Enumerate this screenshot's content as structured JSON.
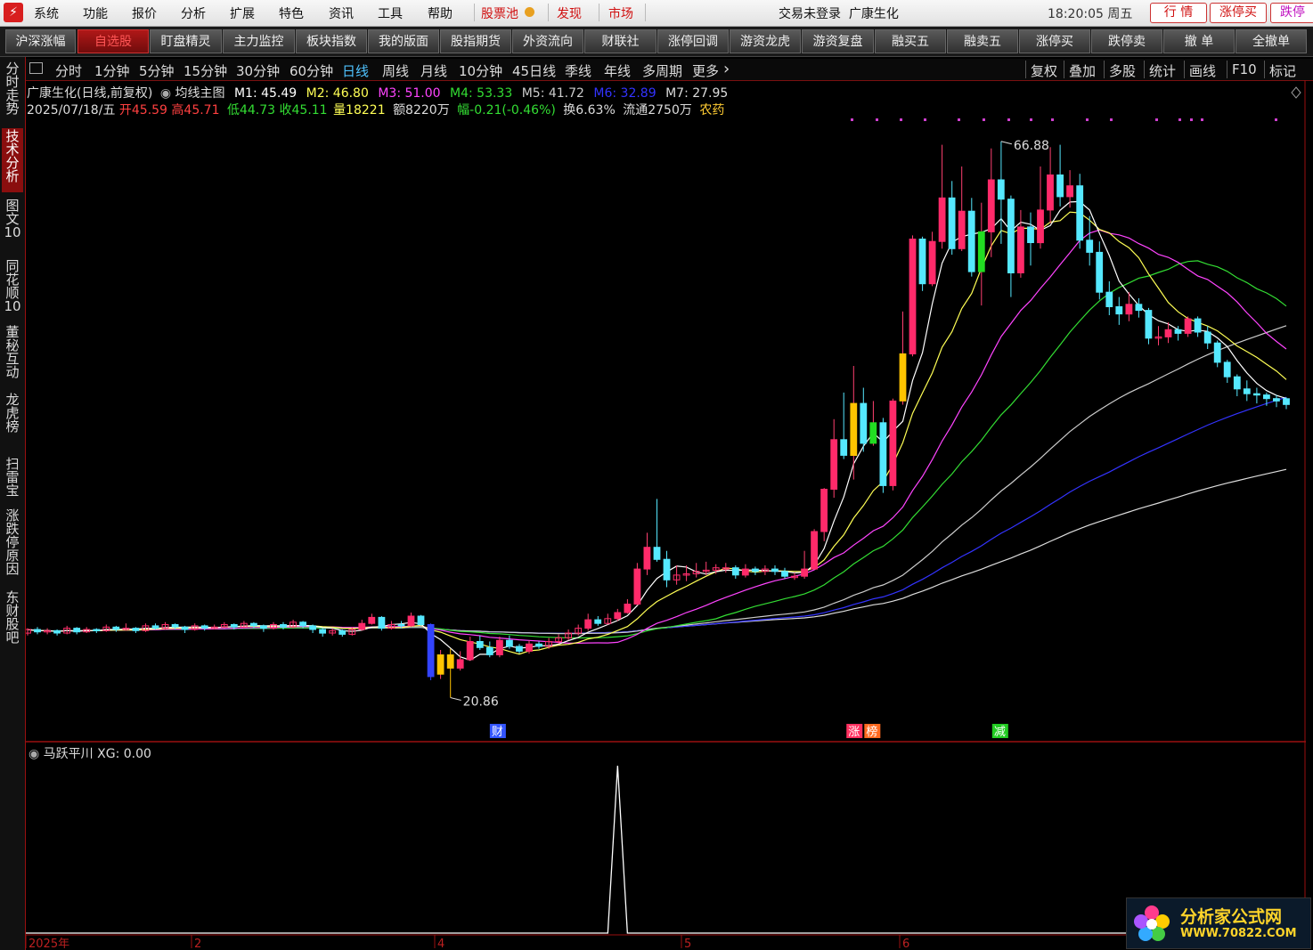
{
  "menubar": {
    "items": [
      "系统",
      "功能",
      "报价",
      "分析",
      "扩展",
      "特色",
      "资讯",
      "工具",
      "帮助"
    ],
    "highlight_items": [
      "股票池",
      "发现",
      "市场"
    ],
    "title": "交易未登录",
    "stock_name": "广康生化",
    "clock": "18:20:05 周五",
    "right_buttons": [
      "行 情",
      "涨停买",
      "跌停"
    ]
  },
  "toolbar": {
    "buttons": [
      "沪深涨幅",
      "自选股",
      "盯盘精灵",
      "主力监控",
      "板块指数",
      "我的版面",
      "股指期货",
      "外资流向",
      "财联社",
      "涨停回调",
      "游资龙虎",
      "游资复盘",
      "融买五",
      "融卖五",
      "涨停买",
      "跌停卖",
      "撤 单",
      "全撤单"
    ]
  },
  "sidebar": {
    "items": [
      "分时走势",
      "技术分析",
      "图文10",
      "同花顺10",
      "董秘互动",
      "龙虎榜",
      "扫雷宝",
      "涨跌停原因",
      "东财股吧"
    ],
    "active": "技术分析"
  },
  "periods": {
    "items": [
      "分时",
      "1分钟",
      "5分钟",
      "15分钟",
      "30分钟",
      "60分钟",
      "日线",
      "周线",
      "月线",
      "10分钟",
      "45日线",
      "季线",
      "年线",
      "多周期",
      "更多"
    ],
    "active": "日线",
    "right_tools": [
      "复权",
      "叠加",
      "多股",
      "统计",
      "画线",
      "F10",
      "标记"
    ]
  },
  "info": {
    "title": "广康生化(日线,前复权)",
    "indicator": "均线主图",
    "m1": "M1: 45.49",
    "m2": "M2: 46.80",
    "m3": "M3: 51.00",
    "m4": "M4: 53.33",
    "m5": "M5: 41.72",
    "m6": "M6: 32.89",
    "m7": "M7: 27.95",
    "date": "2025/07/18/五",
    "open": "开45.59",
    "high": "高45.71",
    "low": "低44.73",
    "close": "收45.11",
    "volume": "量18221",
    "amount": "额8220万",
    "change": "幅-0.21(-0.46%)",
    "turnover": "换6.63%",
    "float": "流通2750万",
    "sector": "农药"
  },
  "chart_data": {
    "type": "candlestick",
    "high_marker": "66.88",
    "low_marker": "20.86",
    "event_labels": [
      "财",
      "涨",
      "榜",
      "减"
    ],
    "ma_colors": {
      "M1": "#ffffff",
      "M2": "#ffff55",
      "M3": "#ff44ff",
      "M4": "#33dd33",
      "M5": "#cccccc",
      "M6": "#3333ff",
      "M7": "#dddddd"
    },
    "candles": [
      [
        26.2,
        26.5,
        26.6,
        26.0
      ],
      [
        26.5,
        26.3,
        26.7,
        26.1
      ],
      [
        26.3,
        26.4,
        26.6,
        26.1
      ],
      [
        26.4,
        26.2,
        26.5,
        26.0
      ],
      [
        26.2,
        26.6,
        26.8,
        26.1
      ],
      [
        26.6,
        26.3,
        26.7,
        26.1
      ],
      [
        26.3,
        26.5,
        26.7,
        26.2
      ],
      [
        26.5,
        26.4,
        26.6,
        26.2
      ],
      [
        26.4,
        26.7,
        26.9,
        26.3
      ],
      [
        26.7,
        26.5,
        26.8,
        26.3
      ],
      [
        26.5,
        26.6,
        27.0,
        26.4
      ],
      [
        26.6,
        26.4,
        26.7,
        26.2
      ],
      [
        26.4,
        26.8,
        27.0,
        26.3
      ],
      [
        26.8,
        26.6,
        27.0,
        26.5
      ],
      [
        26.6,
        26.9,
        27.1,
        26.5
      ],
      [
        26.9,
        26.7,
        27.0,
        26.5
      ],
      [
        26.7,
        26.5,
        26.8,
        26.2
      ],
      [
        26.5,
        26.8,
        27.0,
        26.4
      ],
      [
        26.8,
        26.6,
        26.9,
        26.4
      ],
      [
        26.6,
        26.7,
        26.9,
        26.5
      ],
      [
        26.7,
        26.9,
        27.1,
        26.6
      ],
      [
        26.9,
        26.7,
        27.0,
        26.5
      ],
      [
        26.7,
        27.0,
        27.2,
        26.6
      ],
      [
        27.0,
        26.8,
        27.1,
        26.6
      ],
      [
        26.8,
        26.6,
        26.9,
        26.3
      ],
      [
        26.6,
        26.9,
        27.1,
        26.5
      ],
      [
        26.9,
        26.7,
        27.1,
        26.5
      ],
      [
        26.7,
        27.1,
        27.3,
        26.6
      ],
      [
        27.1,
        26.8,
        27.2,
        26.6
      ],
      [
        26.8,
        26.5,
        26.9,
        26.2
      ],
      [
        26.5,
        26.2,
        26.6,
        25.9
      ],
      [
        26.2,
        26.4,
        26.6,
        26.0
      ],
      [
        26.4,
        26.1,
        26.5,
        25.9
      ],
      [
        26.1,
        26.5,
        26.7,
        26.0
      ],
      [
        26.5,
        27.0,
        27.3,
        26.4
      ],
      [
        27.0,
        27.5,
        27.8,
        26.9
      ],
      [
        27.5,
        26.6,
        27.6,
        26.4
      ],
      [
        26.6,
        26.9,
        27.2,
        26.5
      ],
      [
        26.9,
        26.8,
        27.2,
        26.6
      ],
      [
        26.8,
        27.6,
        27.9,
        26.7
      ],
      [
        27.6,
        26.9,
        27.7,
        26.8
      ],
      [
        26.9,
        22.6,
        27.0,
        22.3
      ],
      [
        22.8,
        24.4,
        24.8,
        22.4
      ],
      [
        24.4,
        23.3,
        24.9,
        20.86
      ],
      [
        23.3,
        24.0,
        24.7,
        23.1
      ],
      [
        24.0,
        25.5,
        25.9,
        23.9
      ],
      [
        25.5,
        25.0,
        26.0,
        24.8
      ],
      [
        25.0,
        24.4,
        25.5,
        24.2
      ],
      [
        24.4,
        25.6,
        25.9,
        24.2
      ],
      [
        25.6,
        25.1,
        26.0,
        24.9
      ],
      [
        25.1,
        24.7,
        25.3,
        24.5
      ],
      [
        24.7,
        25.3,
        25.6,
        24.5
      ],
      [
        25.3,
        25.1,
        25.5,
        24.9
      ],
      [
        25.1,
        25.5,
        25.8,
        24.9
      ],
      [
        25.5,
        25.8,
        26.1,
        25.3
      ],
      [
        25.8,
        26.2,
        26.5,
        25.6
      ],
      [
        26.2,
        26.6,
        26.9,
        26.0
      ],
      [
        26.6,
        27.3,
        27.8,
        26.4
      ],
      [
        27.3,
        27.0,
        27.6,
        26.8
      ],
      [
        27.0,
        27.4,
        27.8,
        26.9
      ],
      [
        27.4,
        27.9,
        28.2,
        27.2
      ],
      [
        27.9,
        28.6,
        29.0,
        27.8
      ],
      [
        28.6,
        31.5,
        32.0,
        28.5
      ],
      [
        31.5,
        33.3,
        34.5,
        31.0
      ],
      [
        33.3,
        32.3,
        37.3,
        32.1
      ],
      [
        32.3,
        30.6,
        33.0,
        30.0
      ],
      [
        30.6,
        31.0,
        31.8,
        30.2
      ],
      [
        31.0,
        31.1,
        31.8,
        30.5
      ],
      [
        31.1,
        31.3,
        32.0,
        30.8
      ],
      [
        31.3,
        31.4,
        32.1,
        31.0
      ],
      [
        31.4,
        31.6,
        31.9,
        31.1
      ],
      [
        31.6,
        31.6,
        32.0,
        31.2
      ],
      [
        31.6,
        31.0,
        31.8,
        30.7
      ],
      [
        31.0,
        31.5,
        31.9,
        30.8
      ],
      [
        31.5,
        31.3,
        31.7,
        31.0
      ],
      [
        31.3,
        31.5,
        31.8,
        31.0
      ],
      [
        31.5,
        31.3,
        31.8,
        31.0
      ],
      [
        31.3,
        30.9,
        31.6,
        30.7
      ],
      [
        30.9,
        30.9,
        31.2,
        30.6
      ],
      [
        30.9,
        31.5,
        33.0,
        30.7
      ],
      [
        31.5,
        34.6,
        34.8,
        31.5
      ],
      [
        34.6,
        38.1,
        38.2,
        33.8
      ],
      [
        38.1,
        42.2,
        43.9,
        37.4
      ],
      [
        42.2,
        40.9,
        46.1,
        40.6
      ],
      [
        40.9,
        45.2,
        48.3,
        38.9
      ],
      [
        45.2,
        41.9,
        46.5,
        41.2
      ],
      [
        41.9,
        43.6,
        45.4,
        41.7
      ],
      [
        43.6,
        38.4,
        44.0,
        37.8
      ],
      [
        38.4,
        45.4,
        45.6,
        38.0
      ],
      [
        45.4,
        49.3,
        52.8,
        45.1
      ],
      [
        49.3,
        58.8,
        59.1,
        49.1
      ],
      [
        58.8,
        55.1,
        59.0,
        54.5
      ],
      [
        55.1,
        58.6,
        59.4,
        54.9
      ],
      [
        58.6,
        62.2,
        66.6,
        58.0
      ],
      [
        62.2,
        58.0,
        63.6,
        57.5
      ],
      [
        58.0,
        61.1,
        64.8,
        57.8
      ],
      [
        61.1,
        56.1,
        62.2,
        55.7
      ],
      [
        56.1,
        59.4,
        61.8,
        53.3
      ],
      [
        59.4,
        63.7,
        66.3,
        57.3
      ],
      [
        63.7,
        62.1,
        66.88,
        58.4
      ],
      [
        62.1,
        56.0,
        62.4,
        54.0
      ],
      [
        56.0,
        59.8,
        61.2,
        55.6
      ],
      [
        59.8,
        58.5,
        61.0,
        56.6
      ],
      [
        58.5,
        61.2,
        64.8,
        58.0
      ],
      [
        61.2,
        64.1,
        66.4,
        60.1
      ],
      [
        64.1,
        62.3,
        66.6,
        61.5
      ],
      [
        62.3,
        63.2,
        64.5,
        61.4
      ],
      [
        63.2,
        58.7,
        64.2,
        58.0
      ],
      [
        58.7,
        57.7,
        60.7,
        56.6
      ],
      [
        57.7,
        54.4,
        58.6,
        53.8
      ],
      [
        54.4,
        53.2,
        55.3,
        52.5
      ],
      [
        53.2,
        52.6,
        54.0,
        51.7
      ],
      [
        52.6,
        53.4,
        54.4,
        52.0
      ],
      [
        53.4,
        52.9,
        53.9,
        52.3
      ],
      [
        52.9,
        50.6,
        53.1,
        50.1
      ],
      [
        50.6,
        50.7,
        51.6,
        50.0
      ],
      [
        50.7,
        51.3,
        51.9,
        50.2
      ],
      [
        51.3,
        51.0,
        51.6,
        50.4
      ],
      [
        51.0,
        52.2,
        52.4,
        50.7
      ],
      [
        52.2,
        51.1,
        52.4,
        50.7
      ],
      [
        51.1,
        50.2,
        51.6,
        49.7
      ],
      [
        50.2,
        48.6,
        50.4,
        48.2
      ],
      [
        48.6,
        47.4,
        48.8,
        46.9
      ],
      [
        47.4,
        46.4,
        47.6,
        45.8
      ],
      [
        46.4,
        46.0,
        47.1,
        45.4
      ],
      [
        46.0,
        45.9,
        46.5,
        45.2
      ],
      [
        45.9,
        45.6,
        46.1,
        45.0
      ],
      [
        45.6,
        45.4,
        45.9,
        44.9
      ],
      [
        45.59,
        45.11,
        45.71,
        44.73
      ]
    ],
    "ylim": [
      19.5,
      69
    ],
    "indicator": {
      "name": "马跃平川",
      "label": "XG: 0.00",
      "signal_index": 60
    },
    "x_axis_labels": [
      "2025年",
      "2",
      "4",
      "5",
      "6"
    ]
  },
  "watermark": {
    "title": "分析家公式网",
    "url": "WWW.70822.COM"
  }
}
